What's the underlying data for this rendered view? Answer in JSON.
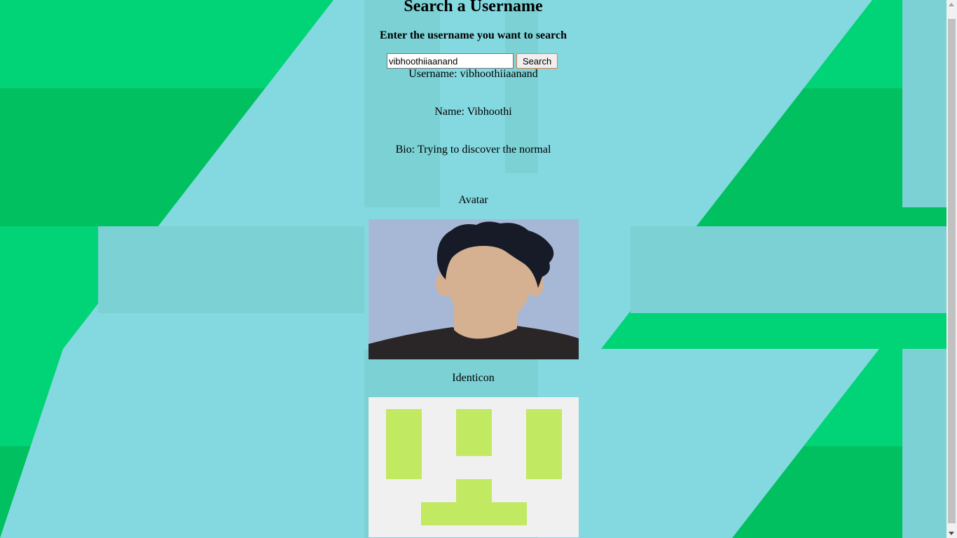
{
  "page": {
    "title": "Search a Username",
    "subtitle": "Enter the username you want to search"
  },
  "search": {
    "value": "vibhoothiiaanand",
    "button_label": "Search"
  },
  "profile": {
    "username_line": "Username: vibhoothiiaanand",
    "name_line": "Name: Vibhoothi",
    "bio_line": "Bio: Trying to discover the normal",
    "avatar_label": "Avatar",
    "identicon_label": "Identicon"
  },
  "colors": {
    "background_green": "#00d476",
    "background_dark_green": "#00c060",
    "background_cyan": "#84d9e0",
    "identicon_fill": "#c1e962",
    "identicon_bg": "#f0f0f0",
    "button_border": "#e07a46"
  }
}
